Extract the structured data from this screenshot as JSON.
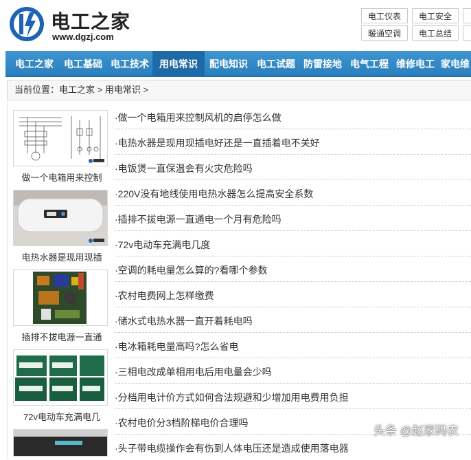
{
  "header": {
    "site_name": "电工之家",
    "site_url": "www.dgzj.com",
    "top_links": [
      "电工仪表",
      "电工安全",
      "暖通空调",
      "电工总结"
    ]
  },
  "nav": {
    "items": [
      "电工之家",
      "电工基础",
      "电工技术",
      "用电常识",
      "配电知识",
      "电工试题",
      "防雷接地",
      "电气工程",
      "维修电工",
      "家电维"
    ],
    "active_index": 3
  },
  "breadcrumb": {
    "label": "当前位置：",
    "home": "电工之家",
    "sep1": " > ",
    "current": "用电常识",
    "sep2": " >"
  },
  "thumbnails": [
    {
      "caption": "做一个电箱用来控制",
      "icon": "circuit-diagram-image"
    },
    {
      "caption": "电热水器是现用现插",
      "icon": "water-heater-image"
    },
    {
      "caption": "插排不拔电源一直通",
      "icon": "power-strip-image"
    },
    {
      "caption": "72v电动车充满电几",
      "icon": "battery-image"
    }
  ],
  "articles": [
    "·做一个电箱用来控制风机的启停怎么做",
    "·电热水器是现用现插电好还是一直插着电不关好",
    "·电饭煲一直保温会有火灾危险吗",
    "·220V没有地线使用电热水器怎么提高安全系数",
    "·插排不拔电源一直通电一个月有危险吗",
    "·72v电动车充满电几度",
    "·空调的耗电量怎么算的?看哪个参数",
    "·农村电费网上怎样缴费",
    "·储水式电热水器一直开着耗电吗",
    "·电冰箱耗电量高吗?怎么省电",
    "·三相电改成单相用电后用电量会少吗",
    "·分档用电计价方式如何合法规避和少增加用电费用负担",
    "·农村电价分3档阶梯电价合理吗",
    "·头子带电缆操作会有伤到人体电压还是造成使用落电器"
  ],
  "watermark": "头条 @赵家码农",
  "colors": {
    "nav": "#2a7fbe",
    "nav_active": "#1e6aa6",
    "logo_blue": "#1f63b4"
  }
}
